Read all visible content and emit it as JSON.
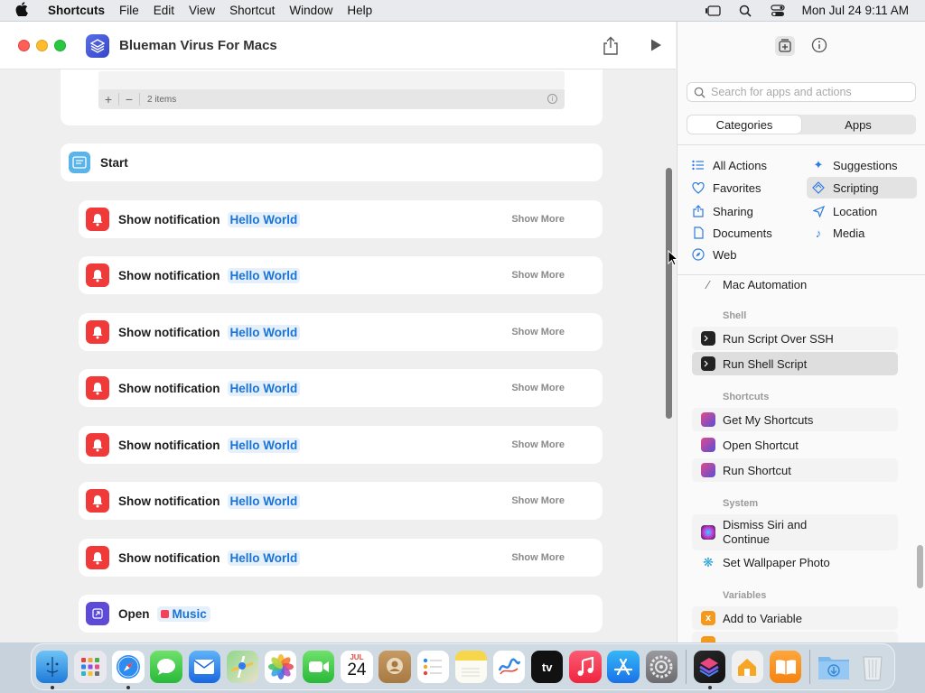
{
  "menubar": {
    "app": "Shortcuts",
    "items": [
      "File",
      "Edit",
      "View",
      "Shortcut",
      "Window",
      "Help"
    ],
    "clock": "Mon Jul 24  9:11 AM"
  },
  "window": {
    "title": "Blueman Virus For Macs"
  },
  "editor": {
    "list_count": "2 items",
    "start_label": "Start",
    "actions": [
      {
        "label": "Show notification",
        "token": "Hello World",
        "more": "Show More"
      },
      {
        "label": "Show notification",
        "token": "Hello World",
        "more": "Show More"
      },
      {
        "label": "Show notification",
        "token": "Hello World",
        "more": "Show More"
      },
      {
        "label": "Show notification",
        "token": "Hello World",
        "more": "Show More"
      },
      {
        "label": "Show notification",
        "token": "Hello World",
        "more": "Show More"
      },
      {
        "label": "Show notification",
        "token": "Hello World",
        "more": "Show More"
      },
      {
        "label": "Show notification",
        "token": "Hello World",
        "more": "Show More"
      }
    ],
    "open_action": {
      "label": "Open",
      "token": "Music"
    }
  },
  "sidebar": {
    "search_placeholder": "Search for apps and actions",
    "segments": [
      "Categories",
      "Apps"
    ],
    "selected_segment": "Categories",
    "categories": [
      {
        "label": "All Actions",
        "icon": "list-icon"
      },
      {
        "label": "Suggestions",
        "icon": "sparkle-icon"
      },
      {
        "label": "Favorites",
        "icon": "heart-icon"
      },
      {
        "label": "Scripting",
        "icon": "scripting-icon",
        "selected": true
      },
      {
        "label": "Sharing",
        "icon": "share-icon"
      },
      {
        "label": "Location",
        "icon": "location-arrow-icon"
      },
      {
        "label": "Documents",
        "icon": "document-icon"
      },
      {
        "label": "Media",
        "icon": "music-note-icon"
      },
      {
        "label": "Web",
        "icon": "compass-icon"
      }
    ],
    "partial_item": "Mac Automation",
    "sections": [
      {
        "title": "Shell",
        "items": [
          "Run Script Over SSH",
          "Run Shell Script"
        ]
      },
      {
        "title": "Shortcuts",
        "items": [
          "Get My Shortcuts",
          "Open Shortcut",
          "Run Shortcut"
        ]
      },
      {
        "title": "System",
        "items": [
          "Dismiss Siri and Continue",
          "Set Wallpaper Photo"
        ]
      },
      {
        "title": "Variables",
        "items": [
          "Add to Variable"
        ]
      }
    ],
    "selected_action": "Run Shell Script"
  },
  "dock": {
    "calendar_month": "JUL",
    "calendar_day": "24",
    "tv_label": "tv"
  },
  "colors": {
    "accent": "#1a74d8",
    "notification_red": "#f03a3a",
    "selection_gray": "#dedede"
  }
}
